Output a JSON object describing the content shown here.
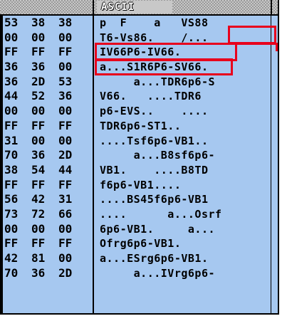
{
  "header": {
    "ascii_label": "ASCII"
  },
  "rows": [
    {
      "hex": [
        "53",
        "38",
        "38"
      ],
      "ascii": "p  F    a   VS88"
    },
    {
      "hex": [
        "00",
        "00",
        "00"
      ],
      "ascii": "T6-Vs86.    /..."
    },
    {
      "hex": [
        "FF",
        "FF",
        "FF"
      ],
      "ascii": "IV66P6-IV66."
    },
    {
      "hex": [
        "36",
        "36",
        "00"
      ],
      "ascii": "a...S1R6P6-SV66."
    },
    {
      "hex": [
        "36",
        "2D",
        "53"
      ],
      "ascii": "     a...TDR6p6-S"
    },
    {
      "hex": [
        "44",
        "52",
        "36"
      ],
      "ascii": "V66.   ....TDR6"
    },
    {
      "hex": [
        "00",
        "00",
        "00"
      ],
      "ascii": "p6-EVS..    ...."
    },
    {
      "hex": [
        "FF",
        "FF",
        "FF"
      ],
      "ascii": "TDR6p6-ST1.."
    },
    {
      "hex": [
        "31",
        "00",
        "00"
      ],
      "ascii": "....Tsf6p6-VB1.."
    },
    {
      "hex": [
        "70",
        "36",
        "2D"
      ],
      "ascii": "     a...B8sf6p6-"
    },
    {
      "hex": [
        "38",
        "54",
        "44"
      ],
      "ascii": "VB1.    ....B8TD"
    },
    {
      "hex": [
        "FF",
        "FF",
        "FF"
      ],
      "ascii": "f6p6-VB1...."
    },
    {
      "hex": [
        "56",
        "42",
        "31"
      ],
      "ascii": "....BS45f6p6-VB1"
    },
    {
      "hex": [
        "73",
        "72",
        "66"
      ],
      "ascii": "....      a...Osrf"
    },
    {
      "hex": [
        "00",
        "00",
        "00"
      ],
      "ascii": "6p6-VB1.     a..."
    },
    {
      "hex": [
        "FF",
        "FF",
        "FF"
      ],
      "ascii": "Ofrg6p6-VB1."
    },
    {
      "hex": [
        "42",
        "81",
        "00"
      ],
      "ascii": "a...ESrg6p6-VB1."
    },
    {
      "hex": [
        "70",
        "36",
        "2D"
      ],
      "ascii": "     a...IVrg6p6-"
    },
    {
      "hex": [
        "",
        "",
        ""
      ],
      "ascii": ""
    }
  ],
  "colors": {
    "background": "#a6c8f0",
    "highlight": "#e8001c",
    "text": "#000000"
  }
}
